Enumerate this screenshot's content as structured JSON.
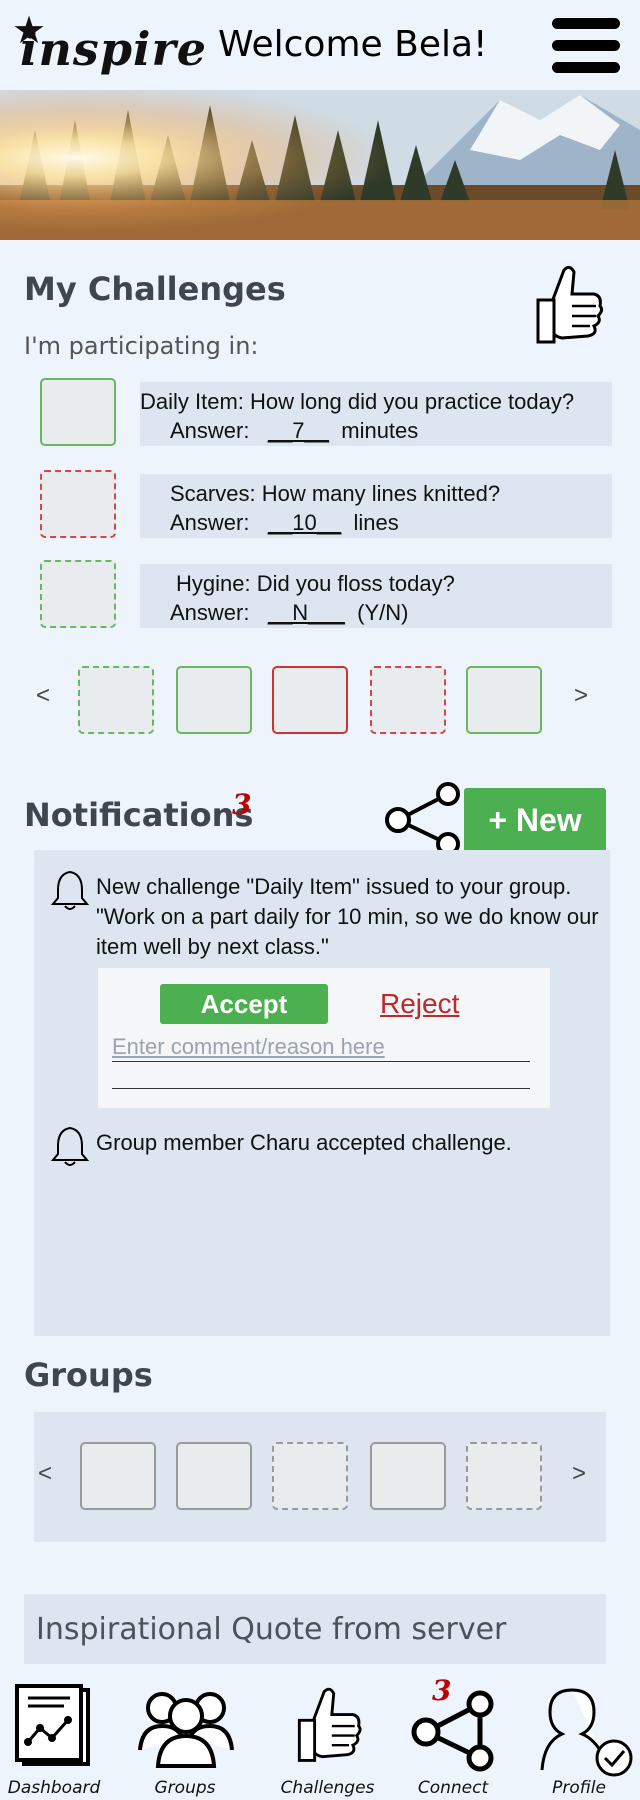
{
  "header": {
    "logo_text": "inspire",
    "welcome": "Welcome Bela!"
  },
  "challenges": {
    "title": "My Challenges",
    "subtitle": "I'm participating in:",
    "items": [
      {
        "question": "Daily Item: How long did you practice today?",
        "answer_prefix": "Answer:",
        "answer_value": "__7__",
        "answer_unit": "minutes"
      },
      {
        "question": "Scarves: How many lines knitted?",
        "answer_prefix": "Answer:",
        "answer_value": "__10__",
        "answer_unit": "lines"
      },
      {
        "question": "Hygine: Did you floss today?",
        "answer_prefix": "Answer:",
        "answer_value": "__N___",
        "answer_unit": "(Y/N)"
      }
    ],
    "prev_arrow": "<",
    "next_arrow": ">"
  },
  "notifications": {
    "title": "Notifications",
    "count": "3",
    "new_button": "+ New",
    "items": [
      {
        "text": "New challenge \"Daily Item\" issued to your group. \"Work on a part daily for 10 min, so we do know our item well by next class.\""
      },
      {
        "text": "Group member Charu accepted challenge."
      }
    ],
    "accept_label": "Accept",
    "reject_label": "Reject",
    "comment_placeholder": "Enter comment/reason here"
  },
  "groups": {
    "title": "Groups",
    "prev_arrow": "<",
    "next_arrow": ">"
  },
  "quote": {
    "text": "Inspirational Quote from server"
  },
  "nav": {
    "items": [
      {
        "label": "Dashboard"
      },
      {
        "label": "Groups"
      },
      {
        "label": "Challenges"
      },
      {
        "label": "Connect",
        "badge": "3"
      },
      {
        "label": "Profile"
      }
    ]
  },
  "colors": {
    "accent_green": "#4caf50",
    "alert_red": "#c00000",
    "panel": "#dde6f0",
    "background": "#eef4fb"
  }
}
